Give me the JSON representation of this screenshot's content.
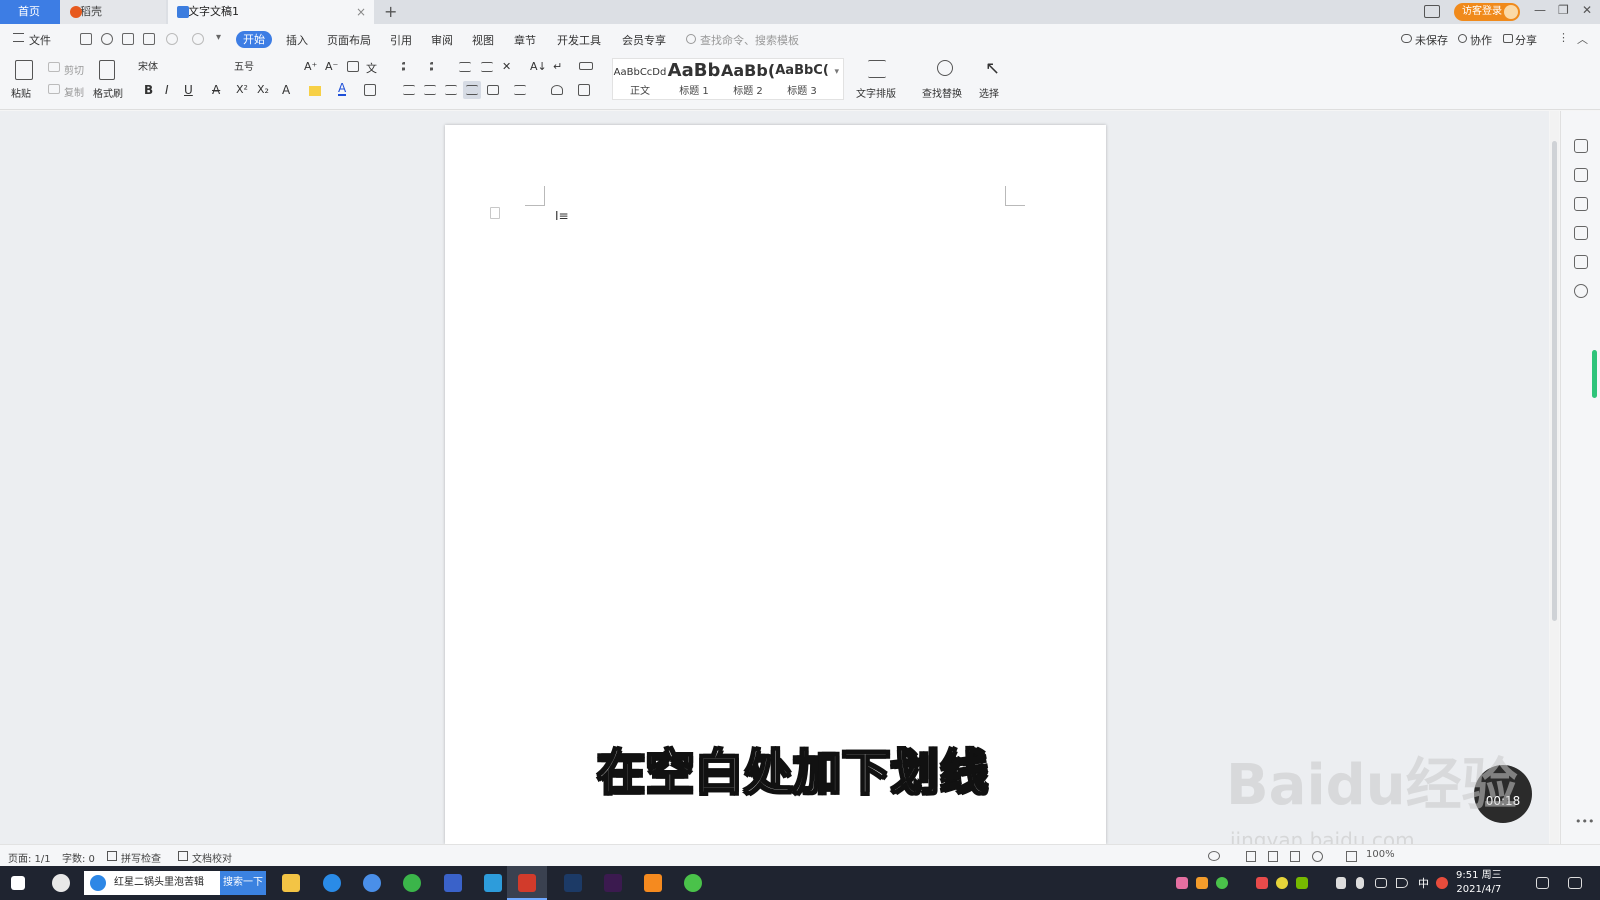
{
  "tabs": {
    "home": "首页",
    "daoke": "稻壳",
    "doc": "文字文稿1",
    "close": "×",
    "new": "+"
  },
  "window": {
    "login": "访客登录",
    "minimize": "—",
    "restore": "❐",
    "close": "✕"
  },
  "menu": {
    "file": "文件",
    "start": "开始",
    "insert": "插入",
    "layout": "页面布局",
    "reference": "引用",
    "review": "审阅",
    "view": "视图",
    "section": "章节",
    "devtools": "开发工具",
    "member": "会员专享",
    "search_placeholder": "查找命令、搜索模板",
    "unsaved": "未保存",
    "collab": "协作",
    "share": "分享"
  },
  "ribbon": {
    "paste": "粘贴",
    "cut": "剪切",
    "copy": "复制",
    "format_painter": "格式刷",
    "font_name": "宋体",
    "font_size": "五号",
    "bold": "B",
    "italic": "I",
    "underline": "U",
    "strike": "A",
    "superscript": "X²",
    "subscript": "X₂",
    "font_color": "A",
    "text_layout": "文字排版",
    "find_replace": "查找替换",
    "select": "选择",
    "styles": [
      {
        "preview": "AaBbCcDd",
        "label": "正文"
      },
      {
        "preview": "AaBb",
        "label": "标题 1"
      },
      {
        "preview": "AaBb(",
        "label": "标题 2"
      },
      {
        "preview": "AaBbC(",
        "label": "标题 3"
      }
    ]
  },
  "document": {
    "subtitle": "在空白处加下划线"
  },
  "overlay": {
    "timer": "00:18",
    "watermark": "Baidu经验",
    "watermark_sub": "jingyan.baidu.com"
  },
  "status": {
    "page": "页面: 1/1",
    "words": "字数: 0",
    "spell_check": "拼写检查",
    "doc_check": "文档校对",
    "zoom": "100%"
  },
  "taskbar": {
    "search_text": "红星二锅头里泡苦辑",
    "search_button": "搜索一下",
    "ime": "中",
    "time": "9:51 周三",
    "date": "2021/4/7"
  },
  "colors": {
    "accent": "#3d7de4",
    "login": "#f08a1b",
    "taskbar": "#1f2430",
    "scroll_indicator": "#2ec47a"
  }
}
